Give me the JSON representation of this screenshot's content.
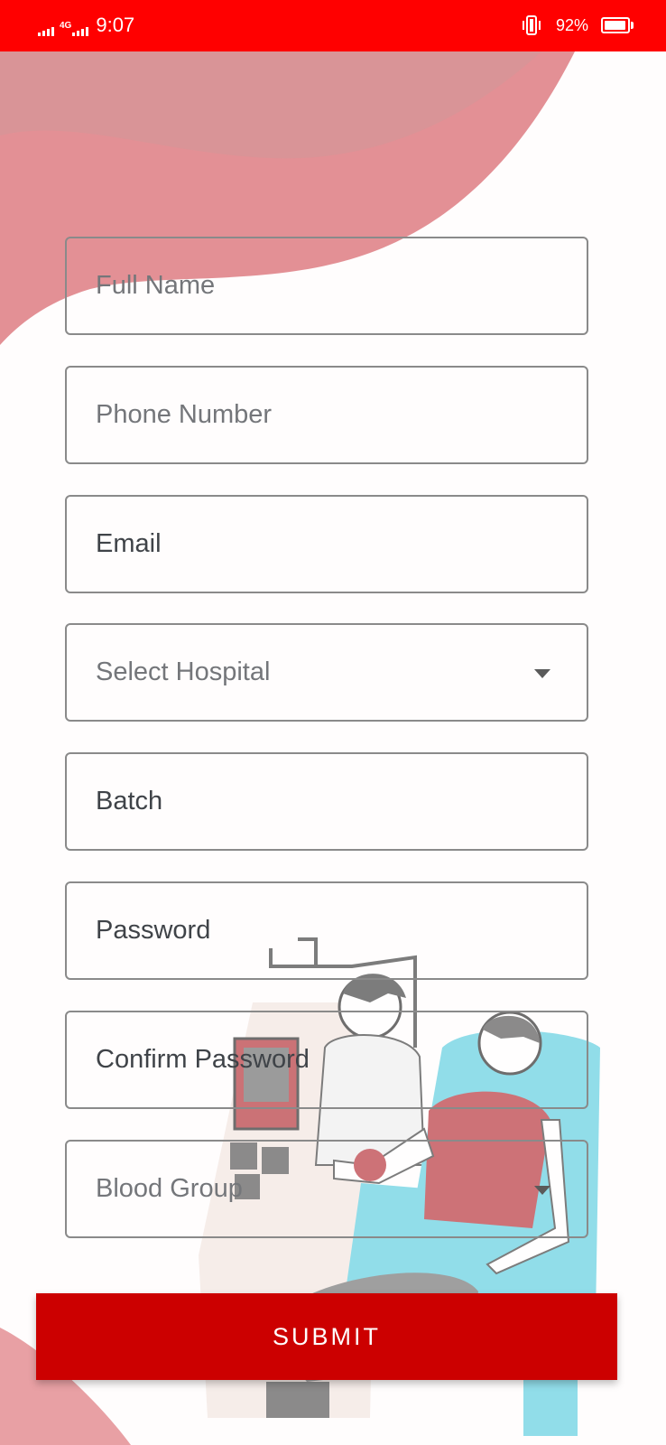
{
  "status_bar": {
    "network": "4G",
    "time": "9:07",
    "battery_percent": "92%",
    "battery_level": 0.92,
    "icons": [
      "signal-icon",
      "4g-signal-icon",
      "vibrate-icon",
      "battery-icon"
    ]
  },
  "form": {
    "full_name": {
      "placeholder": "Full Name"
    },
    "phone_number": {
      "placeholder": "Phone Number"
    },
    "email": {
      "value": "Email"
    },
    "hospital": {
      "placeholder": "Select Hospital"
    },
    "batch": {
      "value": "Batch"
    },
    "password": {
      "value": "Password"
    },
    "confirm_password": {
      "value": "Confirm Password"
    },
    "blood_group": {
      "placeholder": "Blood Group"
    }
  },
  "submit_label": "SUBMIT",
  "colors": {
    "status_bar": "#ff0000",
    "accent": "#cc0000",
    "wave": "#e0868a",
    "field_border": "#8a8a8a"
  }
}
